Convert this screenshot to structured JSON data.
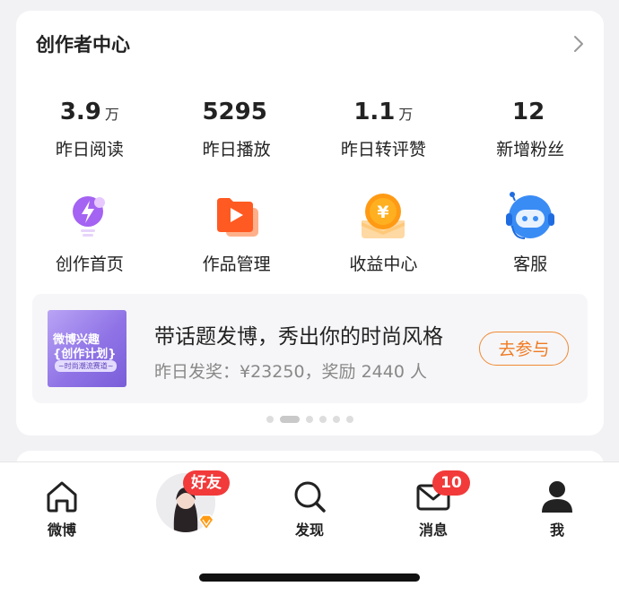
{
  "card": {
    "title": "创作者中心",
    "stats": [
      {
        "value": "3.9",
        "unit": "万",
        "label": "昨日阅读"
      },
      {
        "value": "5295",
        "unit": "",
        "label": "昨日播放"
      },
      {
        "value": "1.1",
        "unit": "万",
        "label": "昨日转评赞"
      },
      {
        "value": "12",
        "unit": "",
        "label": "新增粉丝"
      }
    ],
    "tools": [
      {
        "label": "创作首页",
        "icon": "lightbulb-icon"
      },
      {
        "label": "作品管理",
        "icon": "video-folder-icon"
      },
      {
        "label": "收益中心",
        "icon": "yen-coin-icon"
      },
      {
        "label": "客服",
        "icon": "headset-bot-icon"
      }
    ],
    "banner": {
      "thumb_line1": "微博兴趣",
      "thumb_line2": "{创作计划}",
      "thumb_line3": "~时尚潮流赛道~",
      "title": "带话题发博，秀出你的时尚风格",
      "subtitle": "昨日发奖：¥23250，奖励 2440 人",
      "button": "去参与"
    },
    "carousel": {
      "count": 6,
      "active": 1
    }
  },
  "tabbar": {
    "tabs": [
      {
        "label": "微博",
        "icon": "home-icon"
      },
      {
        "label": "",
        "icon": "friend-avatar"
      },
      {
        "label": "发现",
        "icon": "search-icon"
      },
      {
        "label": "消息",
        "icon": "mail-icon"
      },
      {
        "label": "我",
        "icon": "person-icon"
      }
    ],
    "friend_badge": "好友",
    "message_badge": "10"
  },
  "colors": {
    "accent": "#f07a22",
    "badge": "#f23a3a",
    "banner_bg": "#f6f6f8"
  }
}
